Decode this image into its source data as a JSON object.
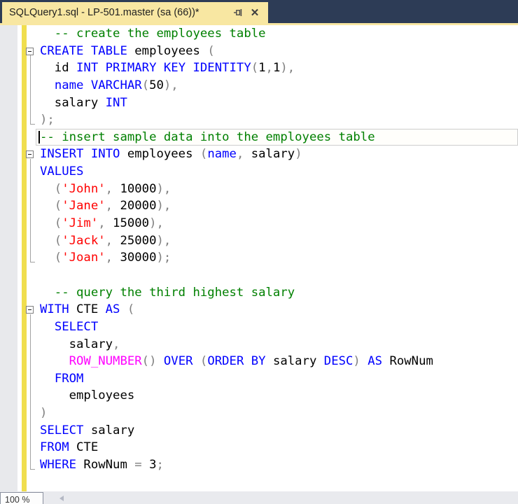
{
  "tab": {
    "title": "SQLQuery1.sql - LP-501.master (sa (66))*",
    "pin_icon": "pin",
    "close_icon": "close"
  },
  "colors": {
    "keyword": "#0000ff",
    "comment": "#008000",
    "string": "#ff0000",
    "operator": "#808080",
    "number": "#000000",
    "identifier": "#000000",
    "sysfunc": "#ff00ff",
    "tab_background": "#f8e7a2",
    "titlebar_background": "#2d3c56",
    "change_tracking_yellow": "#f0de4e",
    "indicator_margin_gray": "#e8e9ec"
  },
  "editor": {
    "current_line": 6,
    "caret_col": 0,
    "folds": [
      {
        "start": 1,
        "end": 5
      },
      {
        "start": 7,
        "end": 13
      },
      {
        "start": 16,
        "end": 25
      }
    ],
    "lines": [
      {
        "tokens": [
          {
            "t": "  -- create the employees table",
            "c": "comment"
          }
        ]
      },
      {
        "fold": true,
        "tokens": [
          {
            "t": "CREATE TABLE",
            "c": "keyword"
          },
          {
            "t": " employees ",
            "c": "identifier"
          },
          {
            "t": "(",
            "c": "operator"
          }
        ]
      },
      {
        "tokens": [
          {
            "t": "  id ",
            "c": "identifier"
          },
          {
            "t": "INT PRIMARY KEY IDENTITY",
            "c": "keyword"
          },
          {
            "t": "(",
            "c": "operator"
          },
          {
            "t": "1",
            "c": "number"
          },
          {
            "t": ",",
            "c": "operator"
          },
          {
            "t": "1",
            "c": "number"
          },
          {
            "t": "),",
            "c": "operator"
          }
        ]
      },
      {
        "tokens": [
          {
            "t": "  ",
            "c": "plain"
          },
          {
            "t": "name",
            "c": "keyword"
          },
          {
            "t": " ",
            "c": "plain"
          },
          {
            "t": "VARCHAR",
            "c": "keyword"
          },
          {
            "t": "(",
            "c": "operator"
          },
          {
            "t": "50",
            "c": "number"
          },
          {
            "t": "),",
            "c": "operator"
          }
        ]
      },
      {
        "tokens": [
          {
            "t": "  salary ",
            "c": "identifier"
          },
          {
            "t": "INT",
            "c": "keyword"
          }
        ]
      },
      {
        "tokens": [
          {
            "t": ");",
            "c": "operator"
          }
        ]
      },
      {
        "tokens": [
          {
            "t": "-- insert sample data into the employees table",
            "c": "comment"
          }
        ]
      },
      {
        "fold": true,
        "tokens": [
          {
            "t": "INSERT INTO",
            "c": "keyword"
          },
          {
            "t": " employees ",
            "c": "identifier"
          },
          {
            "t": "(",
            "c": "operator"
          },
          {
            "t": "name",
            "c": "keyword"
          },
          {
            "t": ",",
            "c": "operator"
          },
          {
            "t": " salary",
            "c": "identifier"
          },
          {
            "t": ")",
            "c": "operator"
          }
        ]
      },
      {
        "tokens": [
          {
            "t": "VALUES",
            "c": "keyword"
          }
        ]
      },
      {
        "tokens": [
          {
            "t": "  (",
            "c": "operator"
          },
          {
            "t": "'John'",
            "c": "string"
          },
          {
            "t": ",",
            "c": "operator"
          },
          {
            "t": " 10000",
            "c": "number"
          },
          {
            "t": "),",
            "c": "operator"
          }
        ]
      },
      {
        "tokens": [
          {
            "t": "  (",
            "c": "operator"
          },
          {
            "t": "'Jane'",
            "c": "string"
          },
          {
            "t": ",",
            "c": "operator"
          },
          {
            "t": " 20000",
            "c": "number"
          },
          {
            "t": "),",
            "c": "operator"
          }
        ]
      },
      {
        "tokens": [
          {
            "t": "  (",
            "c": "operator"
          },
          {
            "t": "'Jim'",
            "c": "string"
          },
          {
            "t": ",",
            "c": "operator"
          },
          {
            "t": " 15000",
            "c": "number"
          },
          {
            "t": "),",
            "c": "operator"
          }
        ]
      },
      {
        "tokens": [
          {
            "t": "  (",
            "c": "operator"
          },
          {
            "t": "'Jack'",
            "c": "string"
          },
          {
            "t": ",",
            "c": "operator"
          },
          {
            "t": " 25000",
            "c": "number"
          },
          {
            "t": "),",
            "c": "operator"
          }
        ]
      },
      {
        "tokens": [
          {
            "t": "  (",
            "c": "operator"
          },
          {
            "t": "'Joan'",
            "c": "string"
          },
          {
            "t": ",",
            "c": "operator"
          },
          {
            "t": " 30000",
            "c": "number"
          },
          {
            "t": ");",
            "c": "operator"
          }
        ]
      },
      {
        "tokens": []
      },
      {
        "tokens": [
          {
            "t": "  -- query the third highest salary",
            "c": "comment"
          }
        ]
      },
      {
        "fold": true,
        "tokens": [
          {
            "t": "WITH",
            "c": "keyword"
          },
          {
            "t": " CTE ",
            "c": "identifier"
          },
          {
            "t": "AS",
            "c": "keyword"
          },
          {
            "t": " ",
            "c": "plain"
          },
          {
            "t": "(",
            "c": "operator"
          }
        ]
      },
      {
        "tokens": [
          {
            "t": "  ",
            "c": "plain"
          },
          {
            "t": "SELECT",
            "c": "keyword"
          }
        ]
      },
      {
        "tokens": [
          {
            "t": "    salary",
            "c": "identifier"
          },
          {
            "t": ",",
            "c": "operator"
          }
        ]
      },
      {
        "tokens": [
          {
            "t": "    ",
            "c": "plain"
          },
          {
            "t": "ROW_NUMBER",
            "c": "sysfunc"
          },
          {
            "t": "()",
            "c": "operator"
          },
          {
            "t": " ",
            "c": "plain"
          },
          {
            "t": "OVER",
            "c": "keyword"
          },
          {
            "t": " ",
            "c": "plain"
          },
          {
            "t": "(",
            "c": "operator"
          },
          {
            "t": "ORDER BY",
            "c": "keyword"
          },
          {
            "t": " salary ",
            "c": "identifier"
          },
          {
            "t": "DESC",
            "c": "keyword"
          },
          {
            "t": ")",
            "c": "operator"
          },
          {
            "t": " ",
            "c": "plain"
          },
          {
            "t": "AS",
            "c": "keyword"
          },
          {
            "t": " RowNum",
            "c": "identifier"
          }
        ]
      },
      {
        "tokens": [
          {
            "t": "  ",
            "c": "plain"
          },
          {
            "t": "FROM",
            "c": "keyword"
          }
        ]
      },
      {
        "tokens": [
          {
            "t": "    employees",
            "c": "identifier"
          }
        ]
      },
      {
        "tokens": [
          {
            "t": ")",
            "c": "operator"
          }
        ]
      },
      {
        "tokens": [
          {
            "t": "SELECT",
            "c": "keyword"
          },
          {
            "t": " salary",
            "c": "identifier"
          }
        ]
      },
      {
        "tokens": [
          {
            "t": "FROM",
            "c": "keyword"
          },
          {
            "t": " CTE",
            "c": "identifier"
          }
        ]
      },
      {
        "tokens": [
          {
            "t": "WHERE",
            "c": "keyword"
          },
          {
            "t": " RowNum ",
            "c": "identifier"
          },
          {
            "t": "=",
            "c": "operator"
          },
          {
            "t": " ",
            "c": "plain"
          },
          {
            "t": "3",
            "c": "number"
          },
          {
            "t": ";",
            "c": "operator"
          }
        ]
      }
    ]
  },
  "statusbar": {
    "zoom_value": "100 %"
  }
}
